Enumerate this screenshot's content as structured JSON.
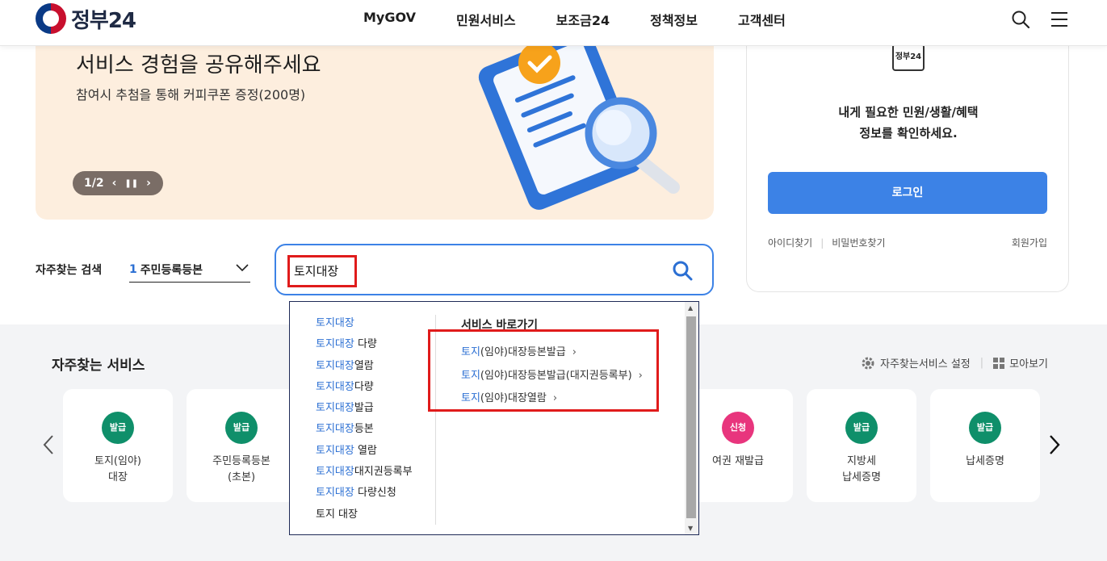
{
  "header": {
    "logo_text": "정부24",
    "nav": [
      "MyGOV",
      "민원서비스",
      "보조금24",
      "정책정보",
      "고객센터"
    ]
  },
  "banner": {
    "title": "서비스 경험을 공유해주세요",
    "subtitle": "참여시 추첨을 통해 커피쿠폰 증정(200명)",
    "pager": "1/2"
  },
  "login": {
    "logo_label": "정부24",
    "message_line1": "내게 필요한 민원/생활/혜택",
    "message_line2": "정보를 확인하세요.",
    "button": "로그인",
    "find_id": "아이디찾기",
    "find_pw": "비밀번호찾기",
    "signup": "회원가입"
  },
  "search": {
    "fav_label": "자주찾는 검색",
    "fav_num": "1",
    "fav_value": "주민등록등본",
    "query": "토지대장"
  },
  "dropdown": {
    "suggestions": [
      {
        "hl": "토지대장",
        "rest": ""
      },
      {
        "hl": "토지대장",
        "rest": " 다량"
      },
      {
        "hl": "토지대장",
        "rest": "열람"
      },
      {
        "hl": "토지대장",
        "rest": "다량"
      },
      {
        "hl": "토지대장",
        "rest": "발급"
      },
      {
        "hl": "토지대장",
        "rest": "등본"
      },
      {
        "hl": "토지대장",
        "rest": " 열람"
      },
      {
        "hl": "토지대장",
        "rest": "대지권등록부"
      },
      {
        "hl": "토지대장",
        "rest": " 다량신청"
      },
      {
        "hl": "",
        "rest": "토지 대장"
      }
    ],
    "section_title": "서비스 바로가기",
    "shortcuts": [
      {
        "hl": "토지",
        "rest": "(임야)대장등본발급"
      },
      {
        "hl": "토지",
        "rest": "(임야)대장등본발급(대지권등록부)"
      },
      {
        "hl": "토지",
        "rest": "(임야)대장열람"
      }
    ]
  },
  "services": {
    "title": "자주찾는 서비스",
    "settings": "자주찾는서비스 설정",
    "view_all": "모아보기",
    "cards": [
      {
        "badge": "발급",
        "badge_color": "#0f8f6a",
        "line1": "토지(임야)",
        "line2": "대장"
      },
      {
        "badge": "발급",
        "badge_color": "#0f8f6a",
        "line1": "주민등록등본",
        "line2": "(초본)"
      },
      {
        "badge": "신청",
        "badge_color": "#e8357d",
        "line1": "여권 재발급",
        "line2": ""
      },
      {
        "badge": "발급",
        "badge_color": "#0f8f6a",
        "line1": "지방세",
        "line2": "납세증명"
      },
      {
        "badge": "발급",
        "badge_color": "#0f8f6a",
        "line1": "납세증명",
        "line2": ""
      }
    ]
  }
}
